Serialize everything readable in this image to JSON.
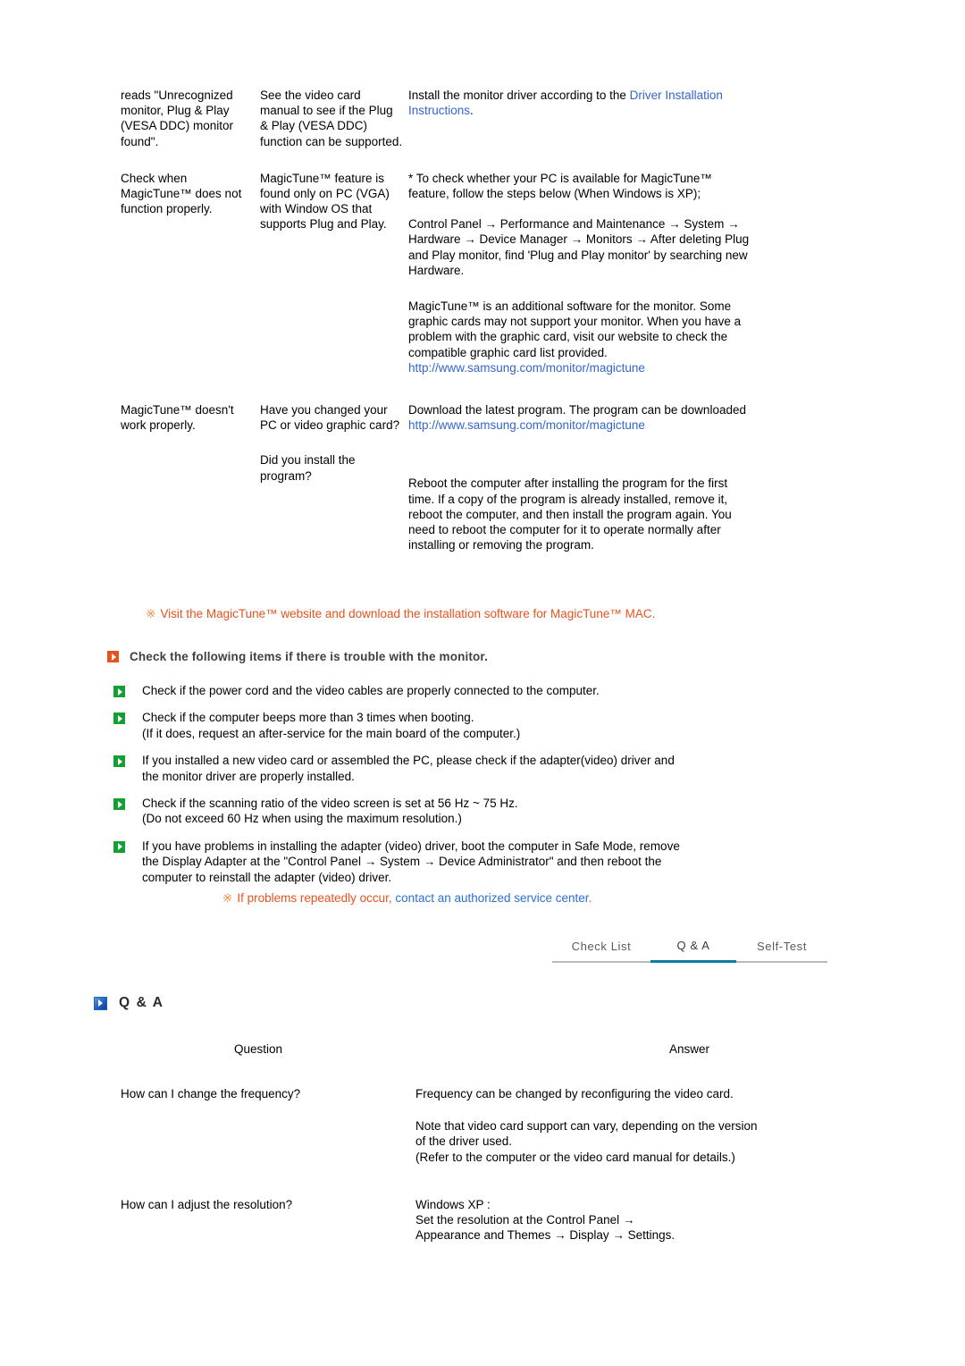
{
  "troubleshooting": {
    "rows": [
      {
        "symptom": "reads \"Unrecognized monitor, Plug & Play (VESA DDC) monitor found\".",
        "checklist": "See the video card manual to see if the Plug & Play (VESA DDC) function can be supported.",
        "solution_pre": "Install the monitor driver according to the ",
        "solution_link": "Driver Installation Instructions",
        "solution_post": "."
      },
      {
        "symptom": "Check when MagicTune™ does not function properly.",
        "checklist": "MagicTune™ feature is found only on PC (VGA) with Window OS that supports Plug and Play.",
        "solution_para1": "* To check whether your PC is available for MagicTune™ feature, follow the steps below (When Windows is XP);",
        "solution_para2": "Control Panel → Performance and Maintenance → System → Hardware → Device Manager → Monitors → After deleting Plug and Play monitor, find 'Plug and Play monitor' by searching new Hardware.",
        "solution_para3": "MagicTune™ is an additional software for the monitor. Some graphic cards may not support your monitor. When you have a problem with the graphic card, visit our website to check the compatible graphic card list provided.",
        "solution_url": "http://www.samsung.com/monitor/magictune"
      },
      {
        "symptom": "MagicTune™ doesn't work properly.",
        "checklist_a": "Have you changed your PC or video graphic card?",
        "checklist_b": "Did you install the program?",
        "solution_a_pre": "Download the latest program. The program can be downloaded ",
        "solution_a_link": "http://www.samsung.com/monitor/magictune",
        "solution_b": "Reboot the computer after installing the program for the first time. If a copy of the program is already installed, remove it, reboot the computer, and then install the program again. You need to reboot the computer for it to operate normally after installing or removing the program."
      }
    ]
  },
  "notices": {
    "magictune_mac": {
      "mark": "※",
      "text": "Visit the MagicTune™ website and download the installation software for MagicTune™ MAC."
    },
    "service_center": {
      "mark": "※",
      "text": "If problems repeatedly occur,",
      "link": "contact an authorized service center",
      "suffix": "."
    }
  },
  "check_section": {
    "icon": "play-square-orange-icon",
    "heading": "Check the following items if there is trouble with the monitor.",
    "items": [
      {
        "icon": "play-square-green-icon",
        "lines": [
          "Check if the power cord and the video cables are properly connected to the computer."
        ]
      },
      {
        "icon": "play-square-green-icon",
        "lines": [
          "Check if the computer beeps more than 3 times when booting.",
          "(If it does, request an after-service for the main board of the computer.)"
        ]
      },
      {
        "icon": "play-square-green-icon",
        "lines": [
          "If you installed a new video card or assembled the PC, please check if the adapter(video) driver and",
          "the monitor driver are properly installed."
        ]
      },
      {
        "icon": "play-square-green-icon",
        "lines": [
          "Check if the scanning ratio of the video screen is set at 56 Hz ~ 75 Hz.",
          "(Do not exceed 60 Hz when using the maximum resolution.)"
        ]
      },
      {
        "icon": "play-square-green-icon",
        "lines": [
          "If you have problems in installing the adapter (video) driver, boot the computer in Safe Mode, remove",
          "the Display Adapter at the \"Control Panel → System → Device Administrator\" and then reboot the",
          "computer to reinstall the adapter (video) driver."
        ]
      }
    ]
  },
  "tabs": {
    "items": [
      {
        "label": "Check List",
        "active": false
      },
      {
        "label": "Q & A",
        "active": true
      },
      {
        "label": "Self-Test",
        "active": false
      }
    ],
    "active_color": "#0b7ea8",
    "inactive_color": "#b9b9b9"
  },
  "qa_section": {
    "icon": "play-square-blue-icon",
    "heading": "Q & A",
    "columns": {
      "question": "Question",
      "answer": "Answer"
    },
    "rows": [
      {
        "question": "How can I change the frequency?",
        "answer_paras": [
          "Frequency can be changed by reconfiguring the video card.",
          "Note that video card support can vary, depending on the version of the driver used.\n(Refer to the computer or the video card manual for details.)"
        ]
      },
      {
        "question": "How can I adjust the resolution?",
        "answer_paras": [
          "Windows XP :\nSet the resolution at the Control Panel →\nAppearance and Themes → Display → Settings."
        ]
      }
    ]
  }
}
